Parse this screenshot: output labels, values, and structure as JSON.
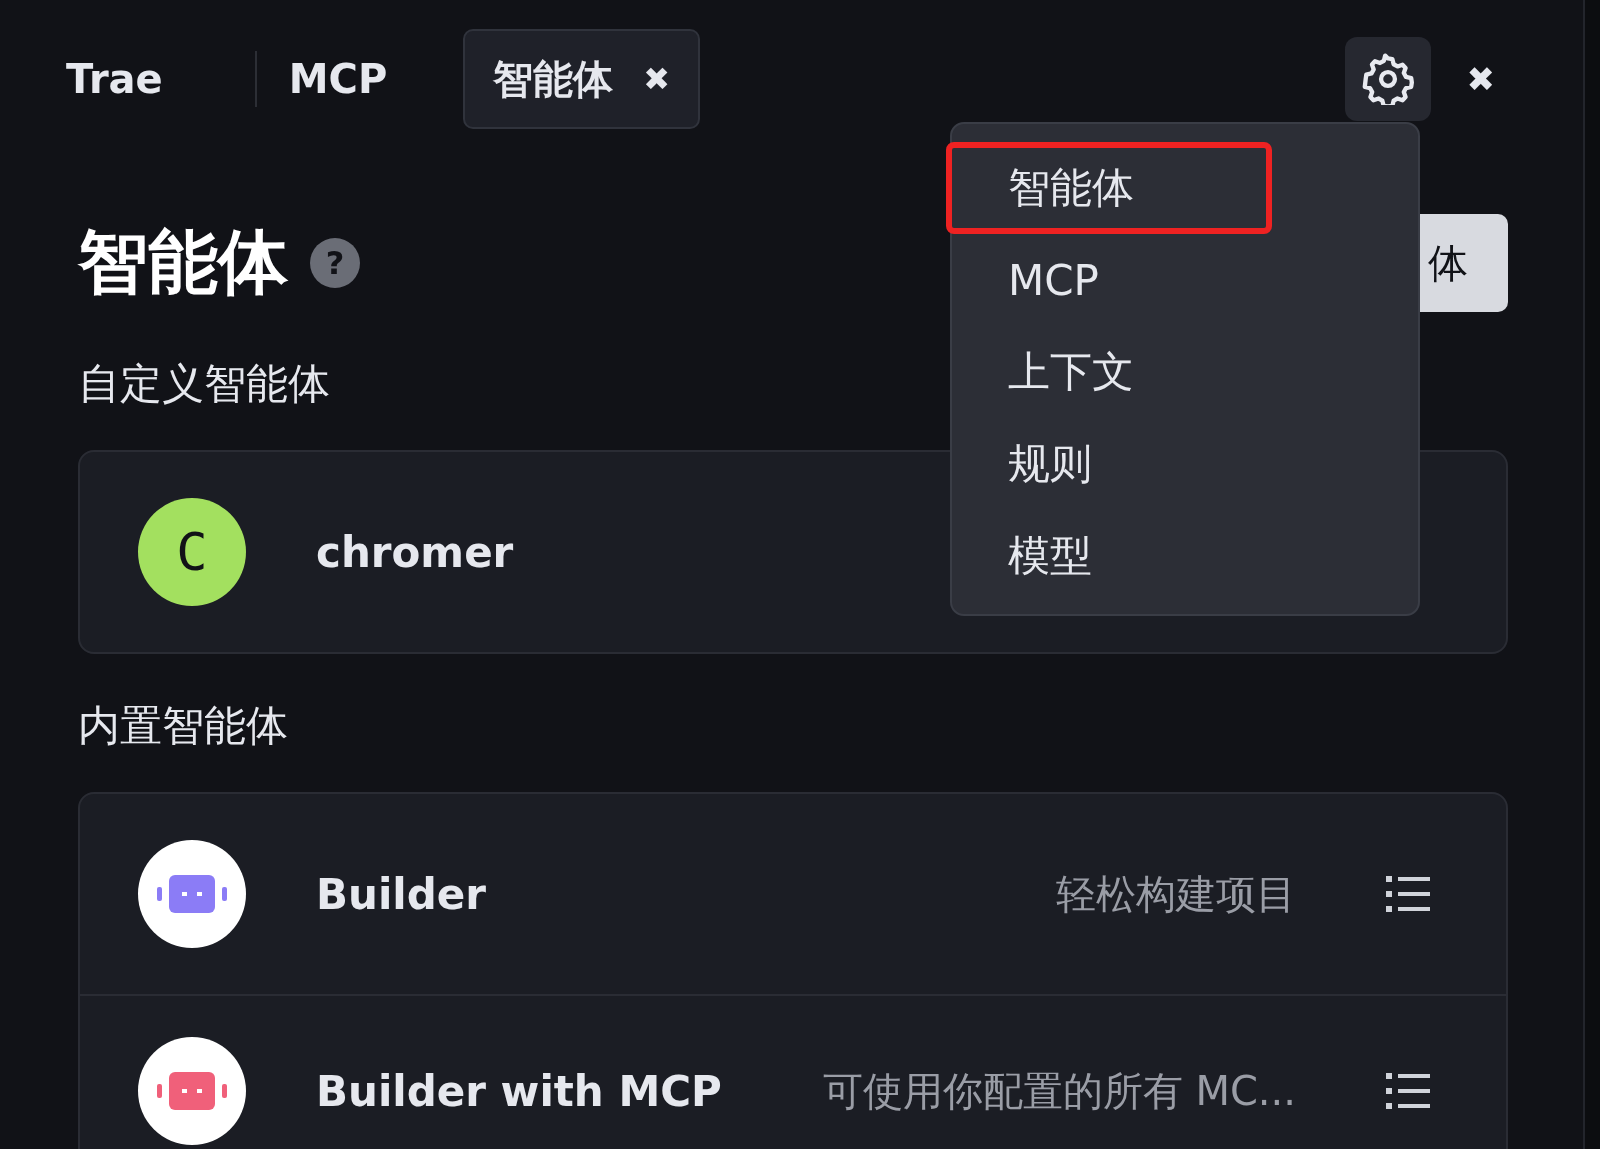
{
  "tabs": [
    {
      "label": "Trae",
      "selected": false,
      "closable": false
    },
    {
      "label": "MCP",
      "selected": false,
      "closable": false
    },
    {
      "label": "智能体",
      "selected": true,
      "closable": true
    }
  ],
  "close_glyph": "✖",
  "window_close": "✖",
  "heading": "智能体",
  "help_glyph": "?",
  "create_button": "体",
  "sections": [
    {
      "title": "自定义智能体",
      "agents": [
        {
          "name": "chromer",
          "avatar": {
            "kind": "letter",
            "letter": "C",
            "color": "#a3e05f"
          }
        }
      ]
    },
    {
      "title": "内置智能体",
      "agents": [
        {
          "name": "Builder",
          "description": "轻松构建项目",
          "avatar": {
            "kind": "robot",
            "color": "#8b7cf6"
          }
        },
        {
          "name": "Builder with MCP",
          "description": "可使用你配置的所有 MC...",
          "avatar": {
            "kind": "robot",
            "color": "#f0607a"
          }
        }
      ]
    }
  ],
  "menu": [
    {
      "label": "智能体",
      "highlighted": true
    },
    {
      "label": "MCP",
      "highlighted": false
    },
    {
      "label": "上下文",
      "highlighted": false
    },
    {
      "label": "规则",
      "highlighted": false
    },
    {
      "label": "模型",
      "highlighted": false
    }
  ]
}
